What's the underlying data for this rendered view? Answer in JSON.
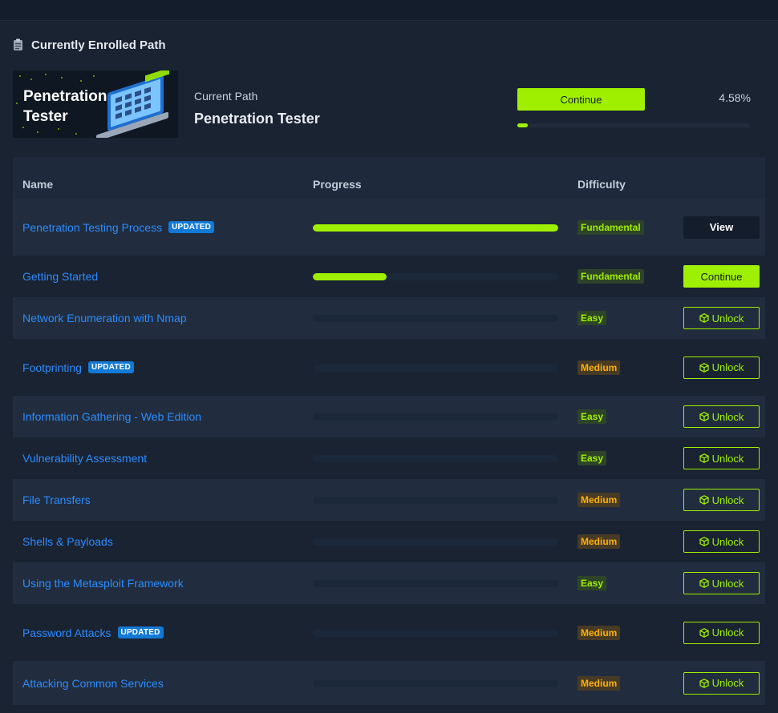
{
  "section": {
    "title": "Currently Enrolled Path",
    "icon": "clipboard-icon"
  },
  "current_path": {
    "banner_line1": "Penetration",
    "banner_line2": "Tester",
    "label": "Current Path",
    "name": "Penetration Tester",
    "continue_label": "Continue",
    "progress_text": "4.58%",
    "progress": 4.58
  },
  "table": {
    "headers": {
      "name": "Name",
      "progress": "Progress",
      "difficulty": "Difficulty"
    },
    "rows": [
      {
        "name": "Penetration Testing Process",
        "updated": "UPDATED",
        "progress": 100,
        "difficulty": "Fundamental",
        "dclass": "fund",
        "action": "View",
        "aclass": "view"
      },
      {
        "name": "Getting Started",
        "updated": "",
        "progress": 30,
        "difficulty": "Fundamental",
        "dclass": "fund",
        "action": "Continue",
        "aclass": "cont"
      },
      {
        "name": "Network Enumeration with Nmap",
        "updated": "",
        "progress": 0,
        "difficulty": "Easy",
        "dclass": "easy",
        "action": "Unlock",
        "aclass": "unlock"
      },
      {
        "name": "Footprinting",
        "updated": "UPDATED",
        "progress": 0,
        "difficulty": "Medium",
        "dclass": "med",
        "action": "Unlock",
        "aclass": "unlock"
      },
      {
        "name": "Information Gathering - Web Edition",
        "updated": "",
        "progress": 0,
        "difficulty": "Easy",
        "dclass": "easy",
        "action": "Unlock",
        "aclass": "unlock"
      },
      {
        "name": "Vulnerability Assessment",
        "updated": "",
        "progress": 0,
        "difficulty": "Easy",
        "dclass": "easy",
        "action": "Unlock",
        "aclass": "unlock"
      },
      {
        "name": "File Transfers",
        "updated": "",
        "progress": 0,
        "difficulty": "Medium",
        "dclass": "med",
        "action": "Unlock",
        "aclass": "unlock"
      },
      {
        "name": "Shells & Payloads",
        "updated": "",
        "progress": 0,
        "difficulty": "Medium",
        "dclass": "med",
        "action": "Unlock",
        "aclass": "unlock"
      },
      {
        "name": "Using the Metasploit Framework",
        "updated": "",
        "progress": 0,
        "difficulty": "Easy",
        "dclass": "easy",
        "action": "Unlock",
        "aclass": "unlock"
      },
      {
        "name": "Password Attacks",
        "updated": "UPDATED",
        "progress": 0,
        "difficulty": "Medium",
        "dclass": "med",
        "action": "Unlock",
        "aclass": "unlock"
      },
      {
        "name": "Attacking Common Services",
        "updated": "",
        "progress": 0,
        "difficulty": "Medium",
        "dclass": "med",
        "action": "Unlock",
        "aclass": "unlock"
      }
    ]
  },
  "colors": {
    "accent": "#9fef00",
    "link": "#2c8bff",
    "updated_badge": "#1279d6",
    "medium": "#ffaf00",
    "background": "#1a2332"
  }
}
